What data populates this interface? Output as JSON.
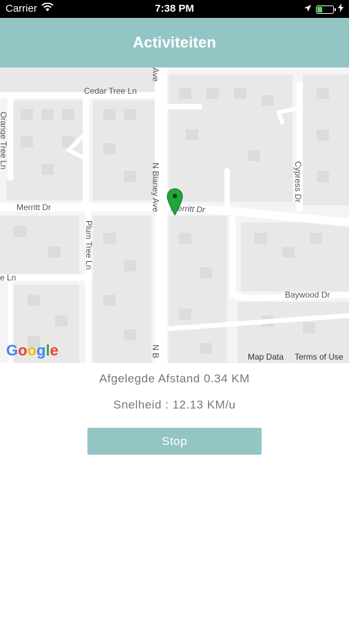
{
  "status_bar": {
    "carrier": "Carrier",
    "time": "7:38 PM",
    "battery_level": 0.35
  },
  "header": {
    "title": "Activiteiten"
  },
  "map": {
    "streets": {
      "cedar": "Cedar Tree Ln",
      "orange": "Orange Tree Ln",
      "blaney_top": "Ave",
      "blaney": "N Blaney Ave",
      "blaney_bottom": "N B",
      "merritt_left": "Merritt Dr",
      "merritt_right": "Merritt Dr",
      "plum": "Plum Tree Ln",
      "cypress": "Cypress Dr",
      "baywood": "Baywood Dr",
      "ln_left": "e Ln"
    },
    "footer": {
      "map_data": "Map Data",
      "terms": "Terms of Use"
    },
    "google_logo": [
      "G",
      "o",
      "o",
      "g",
      "l",
      "e"
    ],
    "marker_color": "#1fa83a"
  },
  "stats": {
    "distance": "Afgelegde Afstand 0.34 KM",
    "speed": "Snelheid : 12.13 KM/u"
  },
  "actions": {
    "stop_label": "Stop"
  },
  "colors": {
    "accent": "#93c5c5"
  }
}
